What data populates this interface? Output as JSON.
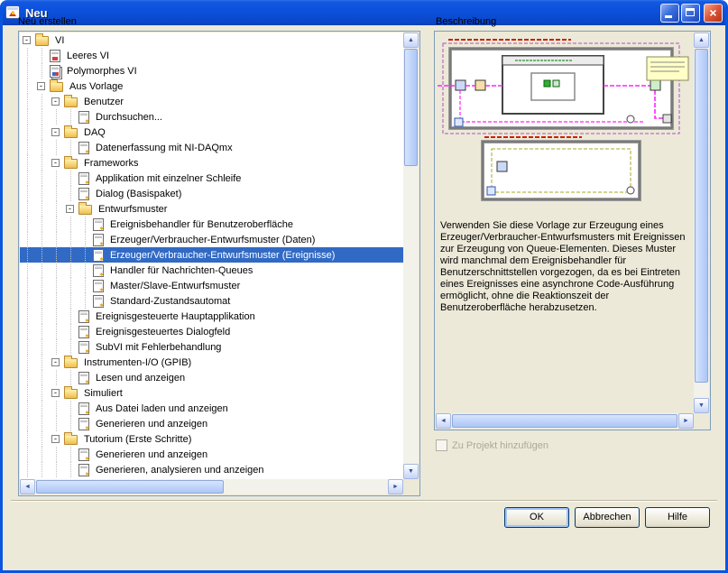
{
  "window": {
    "title": "Neu"
  },
  "panels": {
    "left_label": "Neu erstellen",
    "right_label": "Beschreibung"
  },
  "tree": [
    {
      "label": "VI",
      "level": 0,
      "icon": "folder",
      "expandable": true
    },
    {
      "label": "Leeres VI",
      "level": 1,
      "icon": "vi"
    },
    {
      "label": "Polymorphes VI",
      "level": 1,
      "icon": "poly"
    },
    {
      "label": "Aus Vorlage",
      "level": 1,
      "icon": "folder",
      "expandable": true
    },
    {
      "label": "Benutzer",
      "level": 2,
      "icon": "folder",
      "expandable": true
    },
    {
      "label": "Durchsuchen...",
      "level": 3,
      "icon": "tpl"
    },
    {
      "label": "DAQ",
      "level": 2,
      "icon": "folder",
      "expandable": true
    },
    {
      "label": "Datenerfassung mit NI-DAQmx",
      "level": 3,
      "icon": "tpl"
    },
    {
      "label": "Frameworks",
      "level": 2,
      "icon": "folder",
      "expandable": true
    },
    {
      "label": "Applikation mit einzelner Schleife",
      "level": 3,
      "icon": "tpl"
    },
    {
      "label": "Dialog (Basispaket)",
      "level": 3,
      "icon": "tpl"
    },
    {
      "label": "Entwurfsmuster",
      "level": 3,
      "icon": "folder",
      "expandable": true
    },
    {
      "label": "Ereignisbehandler für Benutzeroberfläche",
      "level": 4,
      "icon": "tpl"
    },
    {
      "label": "Erzeuger/Verbraucher-Entwurfsmuster (Daten)",
      "level": 4,
      "icon": "tpl"
    },
    {
      "label": "Erzeuger/Verbraucher-Entwurfsmuster (Ereignisse)",
      "level": 4,
      "icon": "tpl",
      "selected": true
    },
    {
      "label": "Handler für Nachrichten-Queues",
      "level": 4,
      "icon": "tpl"
    },
    {
      "label": "Master/Slave-Entwurfsmuster",
      "level": 4,
      "icon": "tpl"
    },
    {
      "label": "Standard-Zustandsautomat",
      "level": 4,
      "icon": "tpl"
    },
    {
      "label": "Ereignisgesteuerte Hauptapplikation",
      "level": 3,
      "icon": "tpl"
    },
    {
      "label": "Ereignisgesteuertes Dialogfeld",
      "level": 3,
      "icon": "tpl"
    },
    {
      "label": "SubVI mit Fehlerbehandlung",
      "level": 3,
      "icon": "tpl"
    },
    {
      "label": "Instrumenten-I/O (GPIB)",
      "level": 2,
      "icon": "folder",
      "expandable": true
    },
    {
      "label": "Lesen und anzeigen",
      "level": 3,
      "icon": "tpl"
    },
    {
      "label": "Simuliert",
      "level": 2,
      "icon": "folder",
      "expandable": true
    },
    {
      "label": "Aus Datei laden und anzeigen",
      "level": 3,
      "icon": "tpl"
    },
    {
      "label": "Generieren und anzeigen",
      "level": 3,
      "icon": "tpl"
    },
    {
      "label": "Tutorium (Erste Schritte)",
      "level": 2,
      "icon": "folder",
      "expandable": true
    },
    {
      "label": "Generieren und anzeigen",
      "level": 3,
      "icon": "tpl"
    },
    {
      "label": "Generieren, analysieren und anzeigen",
      "level": 3,
      "icon": "tpl"
    }
  ],
  "description": "Verwenden Sie diese Vorlage zur Erzeugung eines Erzeuger/Verbraucher-Entwurfsmusters mit Ereignissen zur Erzeugung von Queue-Elementen. Dieses Muster wird manchmal dem Ereignisbehandler für Benutzerschnittstellen vorgezogen, da es bei Eintreten eines Ereignisses eine asynchrone Code-Ausführung ermöglicht, ohne die Reaktionszeit der Benutzeroberfläche herabzusetzen.",
  "project_checkbox": {
    "label": "Zu Projekt hinzufügen",
    "checked": false,
    "enabled": false
  },
  "buttons": [
    {
      "label": "OK",
      "default": true
    },
    {
      "label": "Abbrechen"
    },
    {
      "label": "Hilfe"
    }
  ],
  "colors": {
    "selection": "#316AC5",
    "titlebar": "#0A55E0",
    "dialog_bg": "#ECE9D8"
  }
}
